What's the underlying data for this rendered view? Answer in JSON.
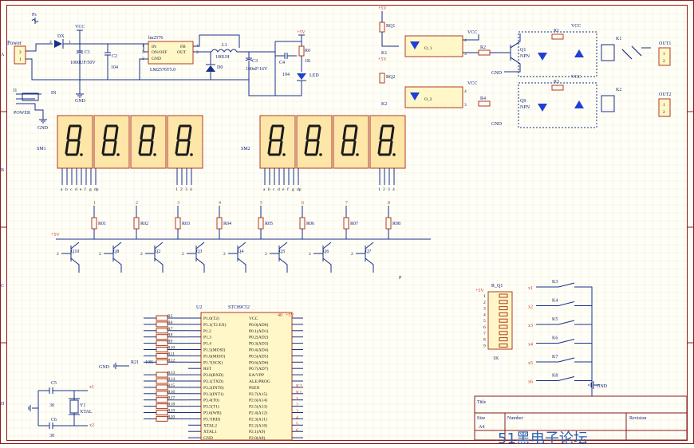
{
  "frame": {
    "row_letters": [
      "A",
      "B",
      "C",
      "D"
    ],
    "title_block": {
      "title_label": "Title",
      "size_label": "Size",
      "size_value": "A4",
      "number_label": "Number",
      "revision_label": "Revision"
    },
    "watermark": "51黑电子论坛"
  },
  "power": {
    "connector_label": "Power",
    "connector_pins": [
      "2",
      "1"
    ],
    "ps_label": "Ps",
    "diode_label": "DX",
    "diode_pins": [
      "2",
      "1"
    ],
    "vcc": "VCC",
    "c1": "C1",
    "c1_value": "1000UF/50V",
    "c2": "C2",
    "c2_value": "104",
    "gnd": "GND",
    "regulator_title": "lm2576",
    "regulator_part": "LM2576T5.0",
    "regulator_pins": {
      "vin": "IN",
      "onoff": "ON/OFF",
      "gnd": "GND",
      "fb": "FB",
      "out": "OUT"
    },
    "regulator_pin_numbers": [
      "1",
      "5",
      "3",
      "4",
      "2"
    ],
    "l1": "L1",
    "l1_value": "100UH",
    "d0": "D0",
    "c3": "C3",
    "c3_value": "100uF/16V",
    "c4": "C4",
    "c4_value": "104",
    "plus5v": "+5V",
    "r0": "R0",
    "r0_value": "1K",
    "led": "LED"
  },
  "jack": {
    "label": "J1",
    "pin": "IN",
    "name": "POWER",
    "gnd": "GND"
  },
  "displays": [
    {
      "label": "SM1",
      "pins": [
        "a",
        "b",
        "c",
        "d",
        "e",
        "f",
        "g",
        "dp",
        "1",
        "2",
        "3",
        "4"
      ]
    },
    {
      "label": "SM2",
      "pins": [
        "a",
        "b",
        "c",
        "d",
        "e",
        "f",
        "g",
        "dp",
        "1",
        "2",
        "3",
        "4"
      ]
    }
  ],
  "drivers": {
    "plus5v": "+5V",
    "resistors": [
      "R01",
      "R02",
      "R03",
      "R04",
      "R05",
      "R06",
      "R07",
      "R08"
    ],
    "nets": [
      "1",
      "2",
      "3",
      "4",
      "5",
      "6",
      "7",
      "8"
    ],
    "transistors": [
      "Q10",
      "Q8",
      "Q2",
      "Q3",
      "Q4",
      "Q5",
      "Q6",
      "Q7"
    ],
    "last_pin": "P"
  },
  "relays": [
    {
      "plus5v": "+5V",
      "rq": "RQ1",
      "k": "K1",
      "opto": "O_1",
      "vcc_a": "VCC",
      "r_in": "R2",
      "q": "Q1",
      "q_type": "NPN",
      "gnd": "GND",
      "r_led": "R1",
      "vcc_b": "VCC",
      "relay": "K1",
      "out": "OUT1",
      "out_pins": [
        "1",
        "2"
      ],
      "opto_pins": [
        "1",
        "2",
        "3",
        "4"
      ]
    },
    {
      "plus5v": "+5V",
      "rq": "RQ2",
      "k": "K2",
      "opto": "O_2",
      "vcc_a": "VCC",
      "r_in": "R4",
      "q": "Q9",
      "q_type": "NPN",
      "gnd": "GND",
      "r_led": "R3",
      "vcc_b": "VCC",
      "relay": "K2",
      "out": "OUT2",
      "out_pins": [
        "1",
        "2"
      ],
      "opto_pins": [
        "1",
        "2",
        "3",
        "4"
      ]
    }
  ],
  "mcu": {
    "ref": "U2",
    "part": "STC89C52",
    "left_pins": [
      "P1.0(T2)",
      "P1.1(T2 EX)",
      "P1.2",
      "P1.3",
      "P1.4",
      "P1.5(MOSI)",
      "P1.6(MISO)",
      "P1.7(SCK)",
      "RST",
      "P3.0(RXD)",
      "P3.1(TXD)",
      "P3.2(INT0)",
      "P3.3(INT1)",
      "P3.4(T0)",
      "P3.5(T1)",
      "P3.6(WR)",
      "P3.7(RD)",
      "XTAL2",
      "XTAL1",
      "GND"
    ],
    "right_pins": [
      "VCC",
      "P0.0(AD0)",
      "P0.1(AD1)",
      "P0.2(AD2)",
      "P0.3(AD3)",
      "P0.4(AD4)",
      "P0.5(AD5)",
      "P0.6(AD6)",
      "P0.7(AD7)",
      "EA/VPP",
      "ALE/PROG",
      "PSEN",
      "P2.7(A15)",
      "P2.6(A14)",
      "P2.5(A13)",
      "P2.4(A12)",
      "P2.3(A11)",
      "P2.2(A10)",
      "P2.1(A9)",
      "P2.0(A8)"
    ],
    "left_resistors": [
      "R5",
      "R6",
      "R7",
      "R8",
      "R9",
      "R10",
      "R11",
      "R12",
      "R13",
      "R14",
      "R15",
      "R16",
      "R17",
      "R18",
      "R19",
      "R20"
    ],
    "vcc_pin": "40",
    "vcc_net": "+5V",
    "rst_label": "R21",
    "rst_value": "10K",
    "gnd": "GND",
    "right_nets": [
      "K2",
      "K1",
      "1",
      "2",
      "3",
      "4",
      "5",
      "6"
    ]
  },
  "crystal": {
    "c5": "C5",
    "c5_value": "30",
    "c6": "C6",
    "c6_value": "30",
    "y": "Y1",
    "y_label": "XTAL",
    "nets": [
      "x1",
      "x2"
    ]
  },
  "keys": {
    "plus5v": "+5V",
    "rq": "R_Q1",
    "rq_value": "1K",
    "pins": [
      "1",
      "2",
      "3",
      "4",
      "5",
      "6",
      "7",
      "8",
      "9"
    ],
    "switches": [
      "K3",
      "K4",
      "K5",
      "K6",
      "K7",
      "K8"
    ],
    "nets": [
      "x1",
      "x2",
      "x3",
      "x4",
      "x5",
      "x6"
    ],
    "gnd": "GND"
  }
}
